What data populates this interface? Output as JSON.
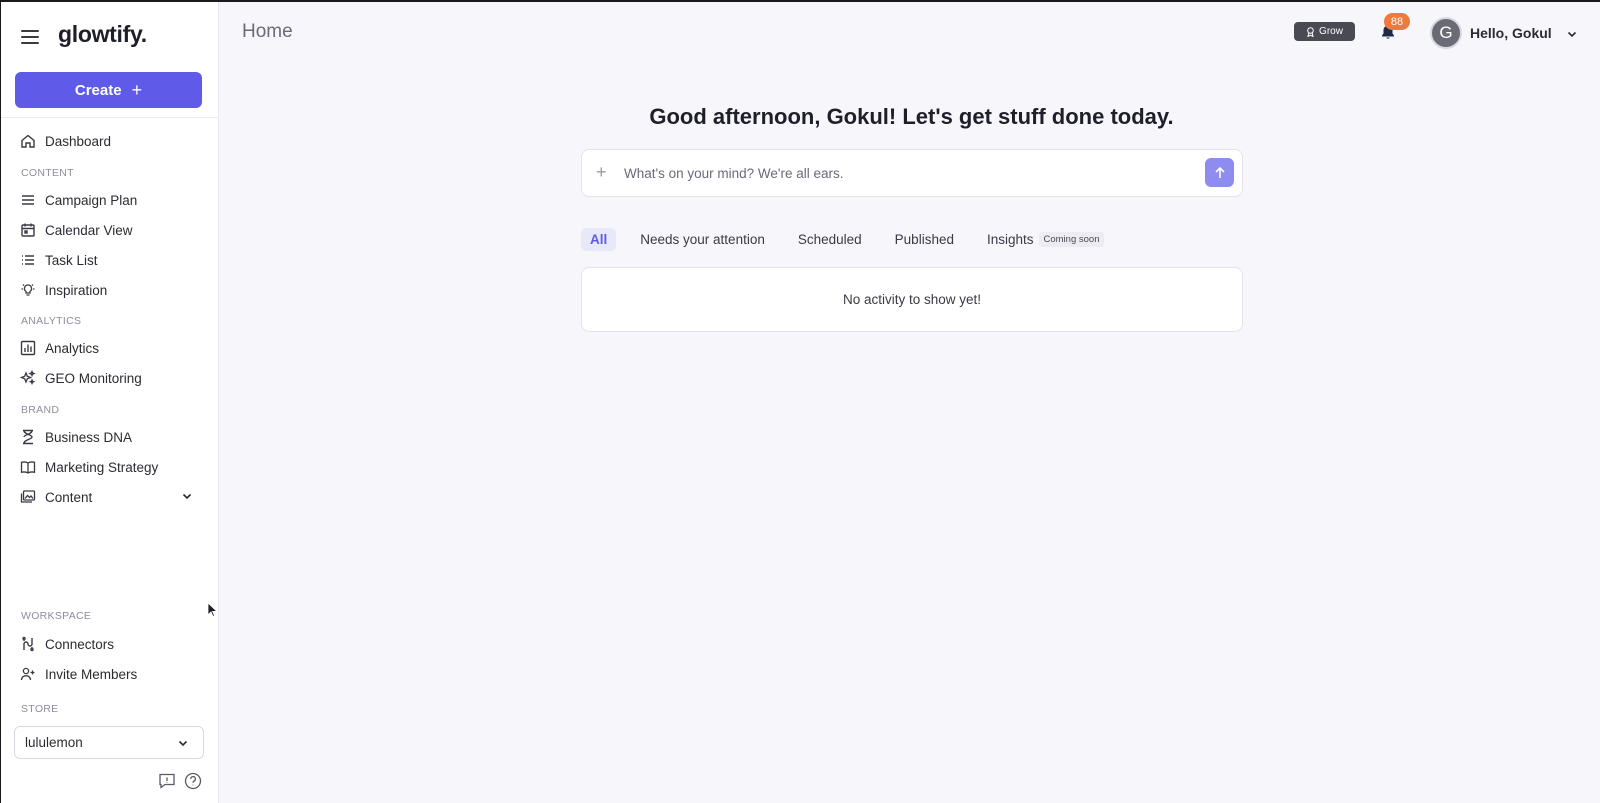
{
  "app": {
    "logo": "glowtify.",
    "create_label": "Create",
    "page_title": "Home"
  },
  "sidebar": {
    "dashboard": "Dashboard",
    "sections": {
      "content": "CONTENT",
      "analytics": "ANALYTICS",
      "brand": "BRAND",
      "workspace": "WORKSPACE",
      "store": "STORE"
    },
    "content_items": [
      "Campaign Plan",
      "Calendar View",
      "Task List",
      "Inspiration"
    ],
    "analytics_items": [
      "Analytics",
      "GEO Monitoring"
    ],
    "brand_items": [
      "Business DNA",
      "Marketing Strategy",
      "Content"
    ],
    "workspace_items": [
      "Connectors",
      "Invite Members"
    ],
    "store_value": "lululemon"
  },
  "header": {
    "plan_badge": "Grow",
    "notification_count": "88",
    "avatar_initial": "G",
    "greeting": "Hello, Gokul"
  },
  "main": {
    "headline": "Good afternoon, Gokul! Let's get stuff done today.",
    "prompt_placeholder": "What's on your mind? We're all ears.",
    "tabs": [
      "All",
      "Needs your attention",
      "Scheduled",
      "Published",
      "Insights"
    ],
    "insights_badge": "Coming soon",
    "empty_state": "No activity to show yet!"
  },
  "colors": {
    "accent": "#5f5ae8",
    "send_button": "#8f8cf0",
    "notification": "#f07a3c",
    "badge": "#4a4a55"
  }
}
